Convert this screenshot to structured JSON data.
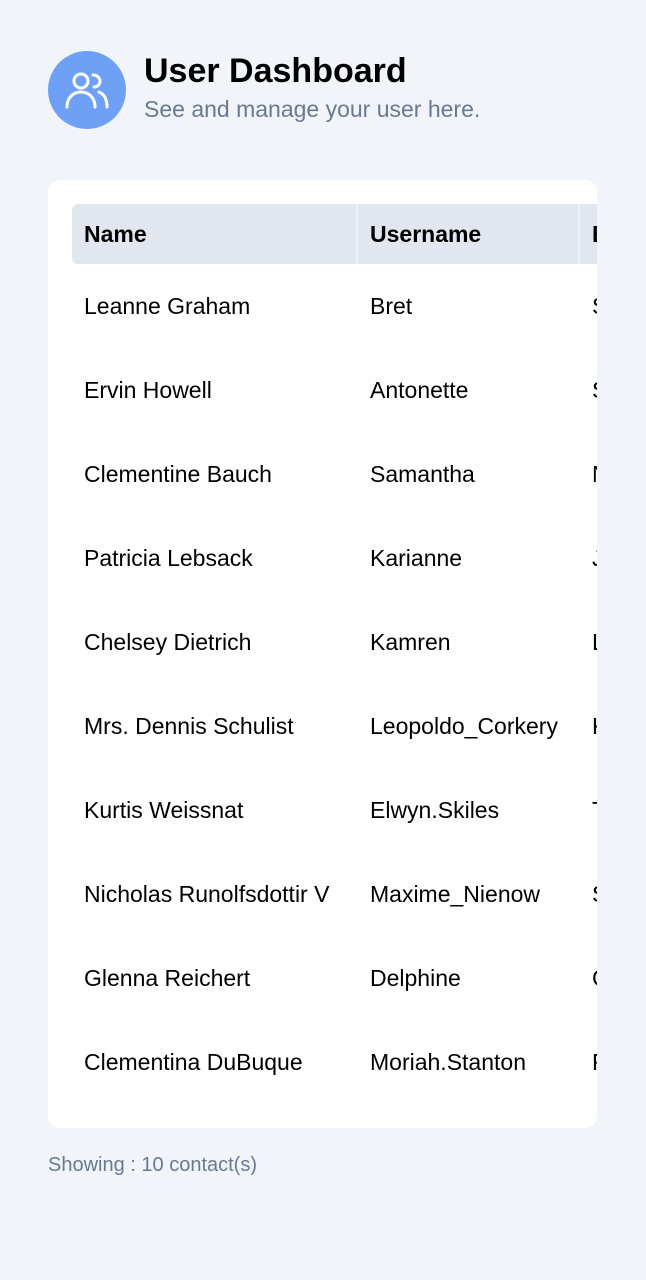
{
  "header": {
    "title": "User Dashboard",
    "subtitle": "See and manage your user here.",
    "avatar_icon": "users-icon",
    "avatar_color": "#6ea1f6"
  },
  "table": {
    "columns": [
      "Name",
      "Username",
      "E"
    ],
    "rows": [
      {
        "name": "Leanne Graham",
        "username": "Bret",
        "email": "S"
      },
      {
        "name": "Ervin Howell",
        "username": "Antonette",
        "email": "S"
      },
      {
        "name": "Clementine Bauch",
        "username": "Samantha",
        "email": "N"
      },
      {
        "name": "Patricia Lebsack",
        "username": "Karianne",
        "email": "J"
      },
      {
        "name": "Chelsey Dietrich",
        "username": "Kamren",
        "email": "L"
      },
      {
        "name": "Mrs. Dennis Schulist",
        "username": "Leopoldo_Corkery",
        "email": "K"
      },
      {
        "name": "Kurtis Weissnat",
        "username": "Elwyn.Skiles",
        "email": "T"
      },
      {
        "name": "Nicholas Runolfsdottir V",
        "username": "Maxime_Nienow",
        "email": "S"
      },
      {
        "name": "Glenna Reichert",
        "username": "Delphine",
        "email": "C"
      },
      {
        "name": "Clementina DuBuque",
        "username": "Moriah.Stanton",
        "email": "R"
      }
    ]
  },
  "footer": {
    "summary": "Showing : 10 contact(s)"
  }
}
